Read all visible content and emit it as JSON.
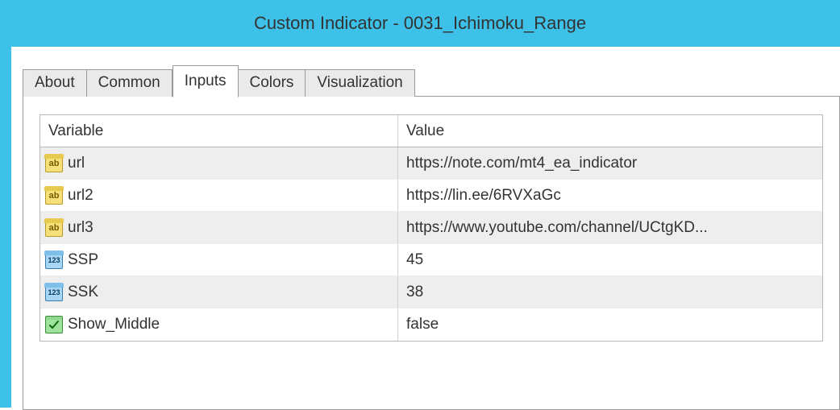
{
  "window": {
    "title": "Custom Indicator - 0031_Ichimoku_Range"
  },
  "tabs": {
    "about": "About",
    "common": "Common",
    "inputs": "Inputs",
    "colors": "Colors",
    "visualization": "Visualization"
  },
  "grid": {
    "headers": {
      "variable": "Variable",
      "value": "Value"
    },
    "rows": [
      {
        "type": "string",
        "name": "url",
        "value": "https://note.com/mt4_ea_indicator"
      },
      {
        "type": "string",
        "name": "url2",
        "value": "https://lin.ee/6RVXaGc"
      },
      {
        "type": "string",
        "name": "url3",
        "value": "https://www.youtube.com/channel/UCtgKD..."
      },
      {
        "type": "int",
        "name": "SSP",
        "value": "45"
      },
      {
        "type": "int",
        "name": "SSK",
        "value": "38"
      },
      {
        "type": "bool",
        "name": "Show_Middle",
        "value": "false"
      }
    ]
  }
}
